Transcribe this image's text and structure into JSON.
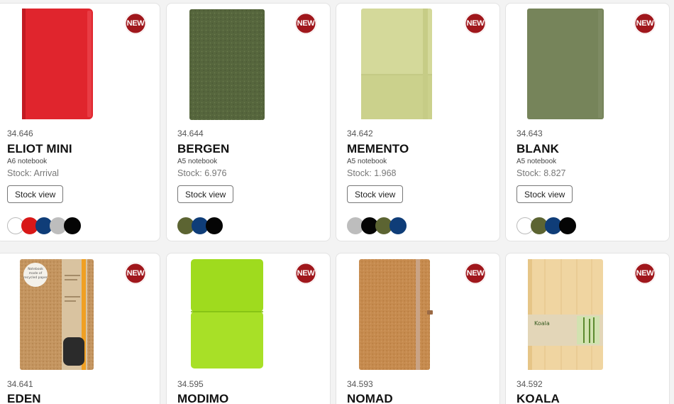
{
  "badge_label": "NEW",
  "products": [
    {
      "sku": "34.646",
      "name": "ELIOT MINI",
      "type": "A6 notebook",
      "stock": "Stock: Arrival",
      "button": "Stock view",
      "swatches": [
        "white",
        "red",
        "navy",
        "grey",
        "black"
      ]
    },
    {
      "sku": "34.644",
      "name": "BERGEN",
      "type": "A5 notebook",
      "stock": "Stock: 6.976",
      "button": "Stock view",
      "swatches": [
        "olive",
        "navy",
        "black"
      ]
    },
    {
      "sku": "34.642",
      "name": "MEMENTO",
      "type": "A5 notebook",
      "stock": "Stock: 1.968",
      "button": "Stock view",
      "swatches": [
        "grey",
        "black",
        "olive",
        "navy"
      ]
    },
    {
      "sku": "34.643",
      "name": "BLANK",
      "type": "A5 notebook",
      "stock": "Stock: 8.827",
      "button": "Stock view",
      "swatches": [
        "white",
        "olive",
        "navy",
        "black"
      ]
    },
    {
      "sku": "34.641",
      "name": "EDEN"
    },
    {
      "sku": "34.595",
      "name": "MODIMO"
    },
    {
      "sku": "34.593",
      "name": "NOMAD"
    },
    {
      "sku": "34.592",
      "name": "KOALA"
    }
  ],
  "image_texts": {
    "eden_sticker": "Notebook made of recycled paper",
    "koala_label": "Koala"
  },
  "colors": {
    "badge": "#a0171c",
    "red_notebook": "#e0252d",
    "bergen_felt": "#56663d",
    "memento_cover": "#d4d99a",
    "blank_cover": "#76845a",
    "cork": "#c08f58",
    "lime_cover": "#9fdb1e",
    "bamboo": "#f0d5a1"
  }
}
